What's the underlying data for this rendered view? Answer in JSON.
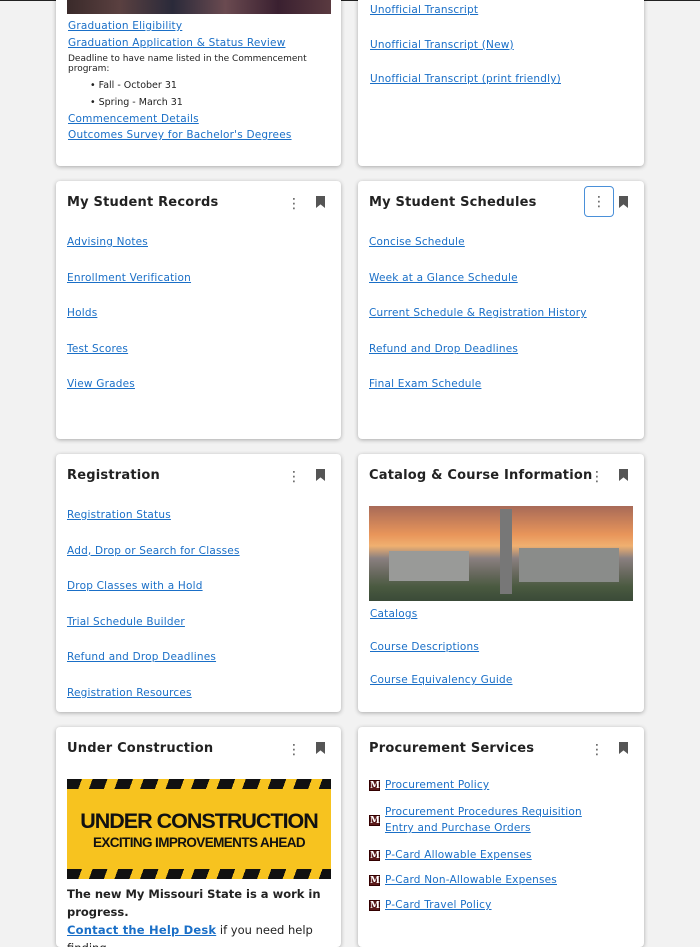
{
  "graduation": {
    "links": [
      "Graduation Eligibility",
      "Graduation Application & Status Review"
    ],
    "deadline_text": "Deadline to have name listed in the Commencement program:",
    "deadlines": [
      "Fall - October 31",
      "Spring - March 31"
    ],
    "links2": [
      "Commencement Details",
      "Outcomes Survey for Bachelor's Degrees"
    ]
  },
  "transcripts": {
    "links": [
      "Unofficial Transcript",
      "Unofficial Transcript (New)",
      "Unofficial Transcript (print friendly)"
    ]
  },
  "records": {
    "title": "My Student Records",
    "links": [
      "Advising Notes",
      "Enrollment Verification",
      "Holds",
      "Test Scores",
      "View Grades"
    ]
  },
  "schedules": {
    "title": "My Student Schedules",
    "links": [
      "Concise Schedule",
      "Week at a Glance Schedule",
      "Current Schedule & Registration History",
      "Refund and Drop Deadlines",
      "Final Exam Schedule"
    ]
  },
  "registration": {
    "title": "Registration",
    "links": [
      "Registration Status",
      "Add, Drop or Search for Classes",
      "Drop Classes with a Hold",
      "Trial Schedule Builder",
      "Refund and Drop Deadlines",
      "Registration Resources"
    ]
  },
  "catalog": {
    "title": "Catalog & Course Information",
    "links": [
      "Catalogs",
      "Course Descriptions",
      "Course Equivalency Guide"
    ]
  },
  "construction": {
    "title": "Under Construction",
    "banner_line1": "UNDER CONSTRUCTION",
    "banner_line2": "EXCITING IMPROVEMENTS AHEAD",
    "body": "The new My Missouri State is a work in progress.",
    "help_link": "Contact the Help Desk",
    "help_rest": " if you need help finding"
  },
  "procurement": {
    "title": "Procurement Services",
    "logo_letter": "M",
    "links": [
      "Procurement Policy",
      "Procurement Procedures Requisition Entry and Purchase Orders",
      "P-Card Allowable Expenses",
      "P-Card Non-Allowable Expenses",
      "P-Card Travel Policy"
    ]
  },
  "icons": {
    "menu": "⋮"
  }
}
